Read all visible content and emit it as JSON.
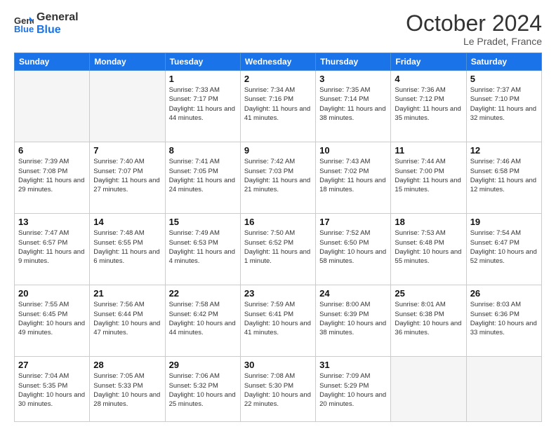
{
  "header": {
    "logo_line1": "General",
    "logo_line2": "Blue",
    "month_title": "October 2024",
    "subtitle": "Le Pradet, France"
  },
  "weekdays": [
    "Sunday",
    "Monday",
    "Tuesday",
    "Wednesday",
    "Thursday",
    "Friday",
    "Saturday"
  ],
  "weeks": [
    [
      {
        "day": "",
        "empty": true
      },
      {
        "day": "",
        "empty": true
      },
      {
        "day": "1",
        "sunrise": "7:33 AM",
        "sunset": "7:17 PM",
        "daylight": "11 hours and 44 minutes."
      },
      {
        "day": "2",
        "sunrise": "7:34 AM",
        "sunset": "7:16 PM",
        "daylight": "11 hours and 41 minutes."
      },
      {
        "day": "3",
        "sunrise": "7:35 AM",
        "sunset": "7:14 PM",
        "daylight": "11 hours and 38 minutes."
      },
      {
        "day": "4",
        "sunrise": "7:36 AM",
        "sunset": "7:12 PM",
        "daylight": "11 hours and 35 minutes."
      },
      {
        "day": "5",
        "sunrise": "7:37 AM",
        "sunset": "7:10 PM",
        "daylight": "11 hours and 32 minutes."
      }
    ],
    [
      {
        "day": "6",
        "sunrise": "7:39 AM",
        "sunset": "7:08 PM",
        "daylight": "11 hours and 29 minutes."
      },
      {
        "day": "7",
        "sunrise": "7:40 AM",
        "sunset": "7:07 PM",
        "daylight": "11 hours and 27 minutes."
      },
      {
        "day": "8",
        "sunrise": "7:41 AM",
        "sunset": "7:05 PM",
        "daylight": "11 hours and 24 minutes."
      },
      {
        "day": "9",
        "sunrise": "7:42 AM",
        "sunset": "7:03 PM",
        "daylight": "11 hours and 21 minutes."
      },
      {
        "day": "10",
        "sunrise": "7:43 AM",
        "sunset": "7:02 PM",
        "daylight": "11 hours and 18 minutes."
      },
      {
        "day": "11",
        "sunrise": "7:44 AM",
        "sunset": "7:00 PM",
        "daylight": "11 hours and 15 minutes."
      },
      {
        "day": "12",
        "sunrise": "7:46 AM",
        "sunset": "6:58 PM",
        "daylight": "11 hours and 12 minutes."
      }
    ],
    [
      {
        "day": "13",
        "sunrise": "7:47 AM",
        "sunset": "6:57 PM",
        "daylight": "11 hours and 9 minutes."
      },
      {
        "day": "14",
        "sunrise": "7:48 AM",
        "sunset": "6:55 PM",
        "daylight": "11 hours and 6 minutes."
      },
      {
        "day": "15",
        "sunrise": "7:49 AM",
        "sunset": "6:53 PM",
        "daylight": "11 hours and 4 minutes."
      },
      {
        "day": "16",
        "sunrise": "7:50 AM",
        "sunset": "6:52 PM",
        "daylight": "11 hours and 1 minute."
      },
      {
        "day": "17",
        "sunrise": "7:52 AM",
        "sunset": "6:50 PM",
        "daylight": "10 hours and 58 minutes."
      },
      {
        "day": "18",
        "sunrise": "7:53 AM",
        "sunset": "6:48 PM",
        "daylight": "10 hours and 55 minutes."
      },
      {
        "day": "19",
        "sunrise": "7:54 AM",
        "sunset": "6:47 PM",
        "daylight": "10 hours and 52 minutes."
      }
    ],
    [
      {
        "day": "20",
        "sunrise": "7:55 AM",
        "sunset": "6:45 PM",
        "daylight": "10 hours and 49 minutes."
      },
      {
        "day": "21",
        "sunrise": "7:56 AM",
        "sunset": "6:44 PM",
        "daylight": "10 hours and 47 minutes."
      },
      {
        "day": "22",
        "sunrise": "7:58 AM",
        "sunset": "6:42 PM",
        "daylight": "10 hours and 44 minutes."
      },
      {
        "day": "23",
        "sunrise": "7:59 AM",
        "sunset": "6:41 PM",
        "daylight": "10 hours and 41 minutes."
      },
      {
        "day": "24",
        "sunrise": "8:00 AM",
        "sunset": "6:39 PM",
        "daylight": "10 hours and 38 minutes."
      },
      {
        "day": "25",
        "sunrise": "8:01 AM",
        "sunset": "6:38 PM",
        "daylight": "10 hours and 36 minutes."
      },
      {
        "day": "26",
        "sunrise": "8:03 AM",
        "sunset": "6:36 PM",
        "daylight": "10 hours and 33 minutes."
      }
    ],
    [
      {
        "day": "27",
        "sunrise": "7:04 AM",
        "sunset": "5:35 PM",
        "daylight": "10 hours and 30 minutes."
      },
      {
        "day": "28",
        "sunrise": "7:05 AM",
        "sunset": "5:33 PM",
        "daylight": "10 hours and 28 minutes."
      },
      {
        "day": "29",
        "sunrise": "7:06 AM",
        "sunset": "5:32 PM",
        "daylight": "10 hours and 25 minutes."
      },
      {
        "day": "30",
        "sunrise": "7:08 AM",
        "sunset": "5:30 PM",
        "daylight": "10 hours and 22 minutes."
      },
      {
        "day": "31",
        "sunrise": "7:09 AM",
        "sunset": "5:29 PM",
        "daylight": "10 hours and 20 minutes."
      },
      {
        "day": "",
        "empty": true
      },
      {
        "day": "",
        "empty": true
      }
    ]
  ]
}
